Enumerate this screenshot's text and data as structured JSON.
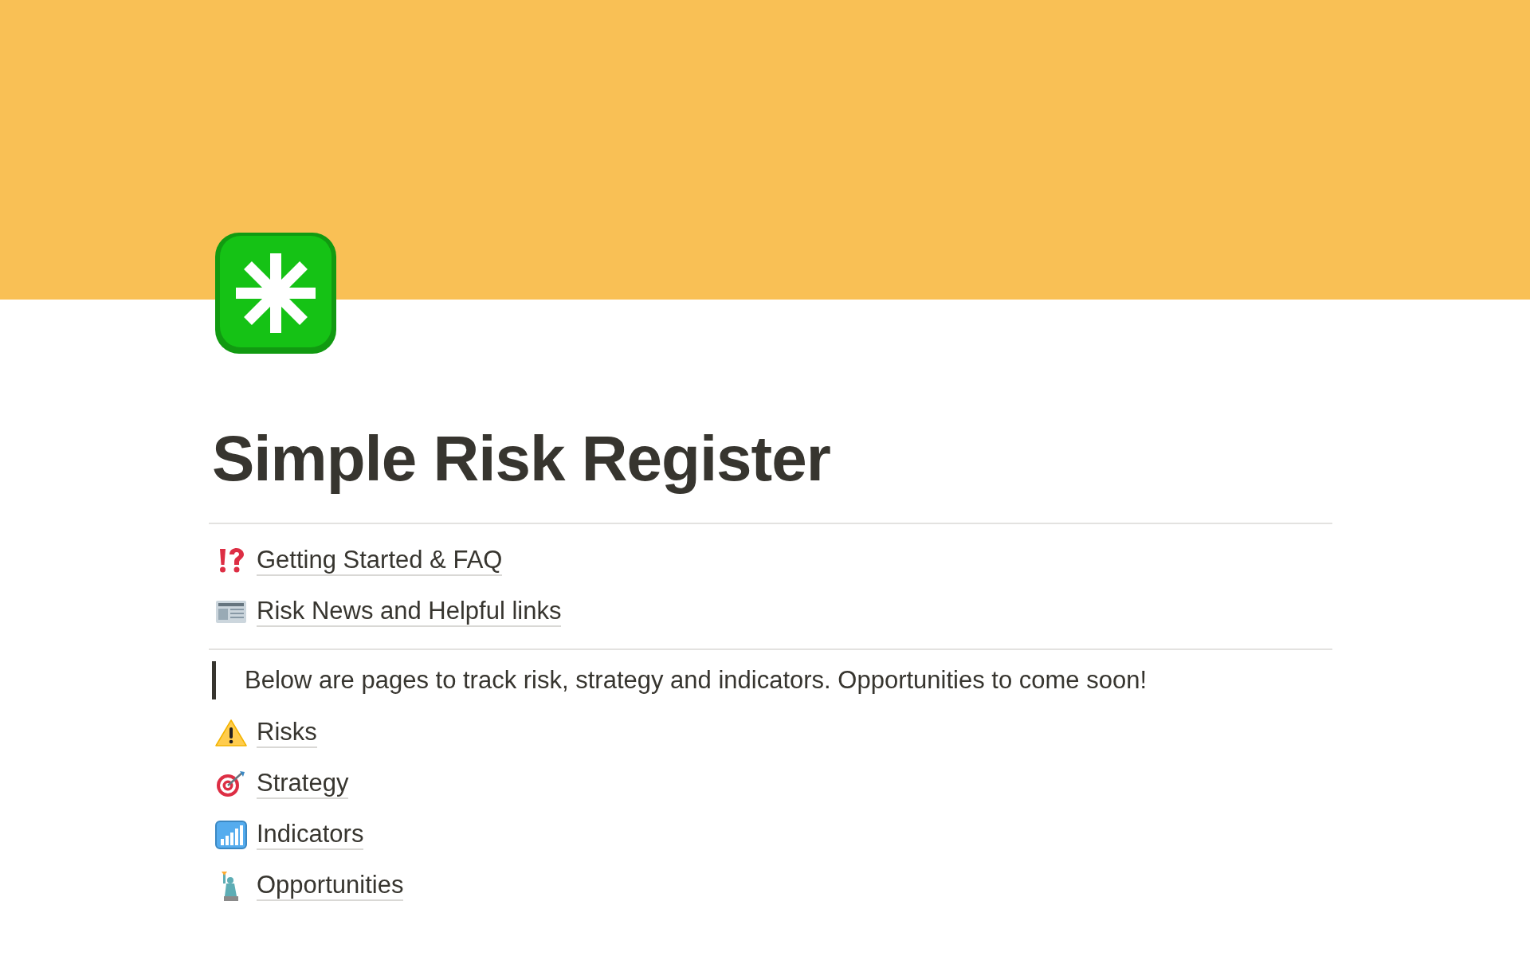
{
  "page": {
    "title": "Simple Risk Register"
  },
  "top_links": [
    {
      "label": "Getting Started & FAQ"
    },
    {
      "label": "Risk News and Helpful links"
    }
  ],
  "quote": "Below are pages to track risk, strategy and indicators. Opportunities to come soon!",
  "pages": [
    {
      "label": "Risks"
    },
    {
      "label": "Strategy"
    },
    {
      "label": "Indicators"
    },
    {
      "label": "Opportunities"
    }
  ]
}
